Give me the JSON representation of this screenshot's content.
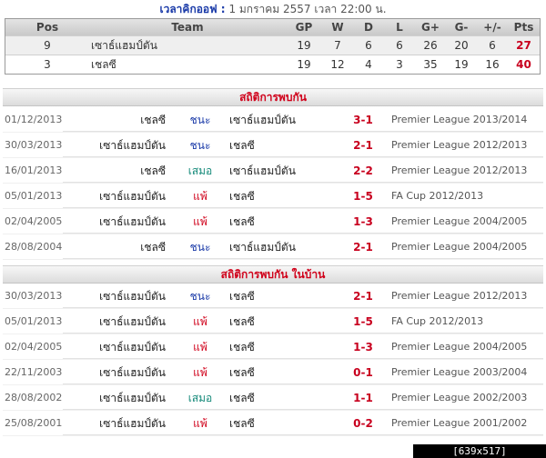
{
  "kickoff": {
    "label": "เวลาคิกออฟ :",
    "value": "1 มกราคม 2557 เวลา 22:00 น."
  },
  "standings": {
    "headers": {
      "pos": "Pos",
      "team": "Team",
      "gp": "GP",
      "w": "W",
      "d": "D",
      "l": "L",
      "gf": "G+",
      "ga": "G-",
      "diff": "+/-",
      "pts": "Pts"
    },
    "rows": [
      {
        "pos": "9",
        "team": "เซาธ์แฮมป์ตัน",
        "gp": "19",
        "w": "7",
        "d": "6",
        "l": "6",
        "gf": "26",
        "ga": "20",
        "diff": "6",
        "pts": "27"
      },
      {
        "pos": "3",
        "team": "เชลซี",
        "gp": "19",
        "w": "12",
        "d": "4",
        "l": "3",
        "gf": "35",
        "ga": "19",
        "diff": "16",
        "pts": "40"
      }
    ]
  },
  "h2h": {
    "title": "สถิติการพบกัน",
    "matches": [
      {
        "date": "01/12/2013",
        "home": "เชลซี",
        "result": "ชนะ",
        "result_type": "win",
        "away": "เซาธ์แฮมป์ตัน",
        "score": "3-1",
        "competition": "Premier League 2013/2014"
      },
      {
        "date": "30/03/2013",
        "home": "เซาธ์แฮมป์ตัน",
        "result": "ชนะ",
        "result_type": "win",
        "away": "เชลซี",
        "score": "2-1",
        "competition": "Premier League 2012/2013"
      },
      {
        "date": "16/01/2013",
        "home": "เชลซี",
        "result": "เสมอ",
        "result_type": "draw",
        "away": "เซาธ์แฮมป์ตัน",
        "score": "2-2",
        "competition": "Premier League 2012/2013"
      },
      {
        "date": "05/01/2013",
        "home": "เซาธ์แฮมป์ตัน",
        "result": "แพ้",
        "result_type": "lose",
        "away": "เชลซี",
        "score": "1-5",
        "competition": "FA Cup 2012/2013"
      },
      {
        "date": "02/04/2005",
        "home": "เซาธ์แฮมป์ตัน",
        "result": "แพ้",
        "result_type": "lose",
        "away": "เชลซี",
        "score": "1-3",
        "competition": "Premier League 2004/2005"
      },
      {
        "date": "28/08/2004",
        "home": "เชลซี",
        "result": "ชนะ",
        "result_type": "win",
        "away": "เซาธ์แฮมป์ตัน",
        "score": "2-1",
        "competition": "Premier League 2004/2005"
      }
    ]
  },
  "h2h_home": {
    "title": "สถิติการพบกัน ในบ้าน",
    "matches": [
      {
        "date": "30/03/2013",
        "home": "เซาธ์แฮมป์ตัน",
        "result": "ชนะ",
        "result_type": "win",
        "away": "เชลซี",
        "score": "2-1",
        "competition": "Premier League 2012/2013"
      },
      {
        "date": "05/01/2013",
        "home": "เซาธ์แฮมป์ตัน",
        "result": "แพ้",
        "result_type": "lose",
        "away": "เชลซี",
        "score": "1-5",
        "competition": "FA Cup 2012/2013"
      },
      {
        "date": "02/04/2005",
        "home": "เซาธ์แฮมป์ตัน",
        "result": "แพ้",
        "result_type": "lose",
        "away": "เชลซี",
        "score": "1-3",
        "competition": "Premier League 2004/2005"
      },
      {
        "date": "22/11/2003",
        "home": "เซาธ์แฮมป์ตัน",
        "result": "แพ้",
        "result_type": "lose",
        "away": "เชลซี",
        "score": "0-1",
        "competition": "Premier League 2003/2004"
      },
      {
        "date": "28/08/2002",
        "home": "เซาธ์แฮมป์ตัน",
        "result": "เสมอ",
        "result_type": "draw",
        "away": "เชลซี",
        "score": "1-1",
        "competition": "Premier League 2002/2003"
      },
      {
        "date": "25/08/2001",
        "home": "เซาธ์แฮมป์ตัน",
        "result": "แพ้",
        "result_type": "lose",
        "away": "เชลซี",
        "score": "0-2",
        "competition": "Premier League 2001/2002"
      }
    ]
  },
  "watermark": "[639x517] http://upic.me/"
}
